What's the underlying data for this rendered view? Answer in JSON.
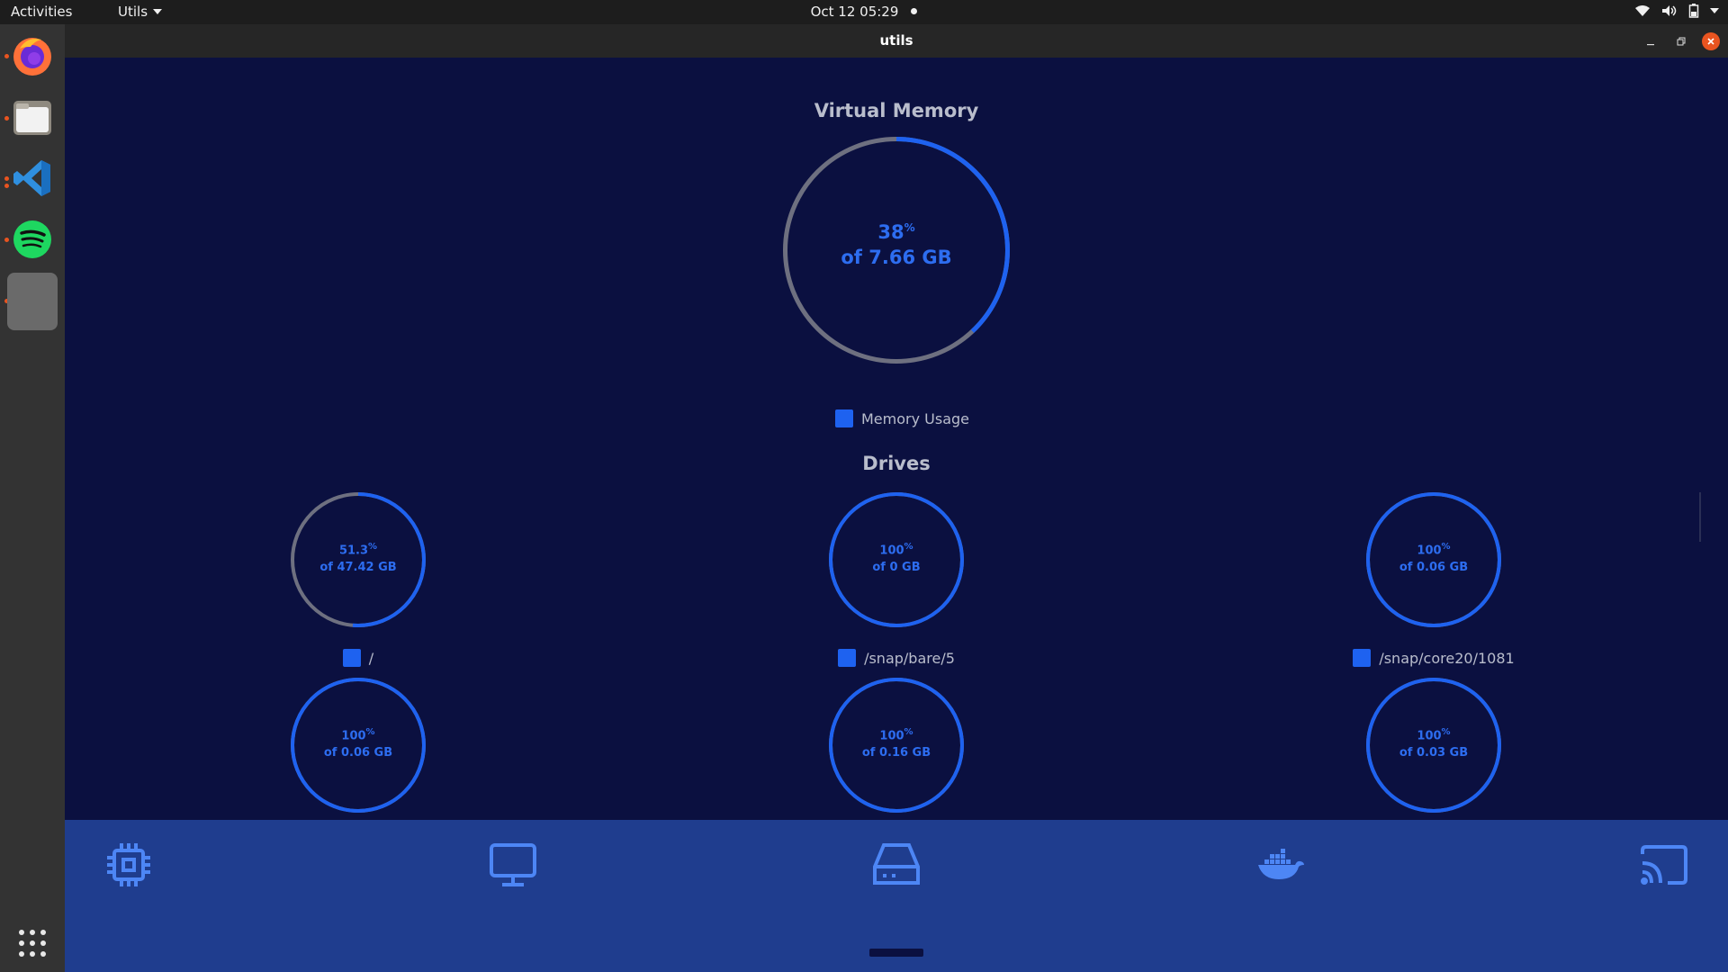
{
  "topbar": {
    "activities": "Activities",
    "app_menu": "Utils",
    "clock": "Oct 12  05:29"
  },
  "window": {
    "title": "utils"
  },
  "memory": {
    "title": "Virtual Memory",
    "percent": "38",
    "percent_sign": "%",
    "total": "of 7.66 GB",
    "usage_fraction": 0.38,
    "legend": "Memory Usage"
  },
  "drives": {
    "title": "Drives",
    "items": [
      {
        "percent": "51.3",
        "total": "of 47.42 GB",
        "fraction": 0.513,
        "label": "/"
      },
      {
        "percent": "100",
        "total": "of 0 GB",
        "fraction": 1.0,
        "label": "/snap/bare/5"
      },
      {
        "percent": "100",
        "total": "of 0.06 GB",
        "fraction": 1.0,
        "label": "/snap/core20/1081"
      },
      {
        "percent": "100",
        "total": "of 0.06 GB",
        "fraction": 1.0,
        "label": ""
      },
      {
        "percent": "100",
        "total": "of 0.16 GB",
        "fraction": 1.0,
        "label": ""
      },
      {
        "percent": "100",
        "total": "of 0.03 GB",
        "fraction": 1.0,
        "label": ""
      }
    ]
  },
  "nav": {
    "items": [
      "cpu-icon",
      "monitor-icon",
      "hard-drive-icon",
      "docker-icon",
      "cast-icon"
    ],
    "active_index": 2
  },
  "colors": {
    "accent": "#1e62f0",
    "track": "#6e7080",
    "background": "#0b1040",
    "nav": "#1f3d8e"
  }
}
